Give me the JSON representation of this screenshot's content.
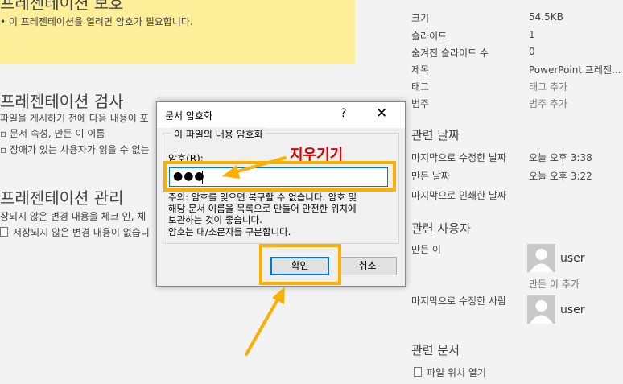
{
  "left": {
    "protect_title": "프레젠테이션 보호",
    "protect_desc": "이 프레젠테이션을 열려면 암호가 필요합니다.",
    "inspect_title": "프레젠테이션 검사",
    "inspect_desc": "파일을 게시하기 전에 다음 내용이 포",
    "inspect_item1": "문서 속성, 만든 이 이름",
    "inspect_item2": "장애가 있는 사용자가 읽을 수 없는",
    "manage_title": "프레젠테이션 관리",
    "manage_desc": "장되지 않은 변경 내용을 체크 인, 체",
    "manage_item": "저장되지 않은 변경 내용이 없습니"
  },
  "properties": {
    "size_label": "크기",
    "size_value": "54.5KB",
    "slides_label": "슬라이드",
    "slides_value": "1",
    "hidden_label": "숨겨진 슬라이드 수",
    "hidden_value": "0",
    "title_label": "제목",
    "title_value": "PowerPoint 프레젠...",
    "tags_label": "태그",
    "tags_value": "태그 추가",
    "category_label": "범주",
    "category_value": "범주 추가"
  },
  "dates": {
    "heading": "관련 날짜",
    "modified_label": "마지막으로 수정한 날짜",
    "modified_value": "오늘 오후 3:38",
    "created_label": "만든 날짜",
    "created_value": "오늘 오후 3:22",
    "printed_label": "마지막으로 인쇄한 날짜"
  },
  "people": {
    "heading": "관련 사용자",
    "author_label": "만든 이",
    "author_name": "user",
    "add_author": "만든 이 추가",
    "last_modified_label": "마지막으로 수정한 사람",
    "last_modified_name": "user"
  },
  "documents": {
    "heading": "관련 문서",
    "open_location": "파일 위치 열기"
  },
  "dialog": {
    "title": "문서 암호화",
    "help": "?",
    "close": "✕",
    "group_label": "이 파일의 내용 암호화",
    "password_label": "암호(R):",
    "password_value": "●●●",
    "warning_line1": "주의: 암호를 잊으면 복구할 수 없습니다. 암호 및",
    "warning_line2": "해당 문서 이름을 목록으로 만들어 안전한 위치에",
    "warning_line3": "보관하는 것이 좋습니다.",
    "warning_line4": "암호는 대/소문자를 구분합니다.",
    "ok": "확인",
    "cancel": "취소"
  },
  "annotation": {
    "label": "지우기기",
    "color": "#fbb000",
    "label_color": "#e00000"
  }
}
